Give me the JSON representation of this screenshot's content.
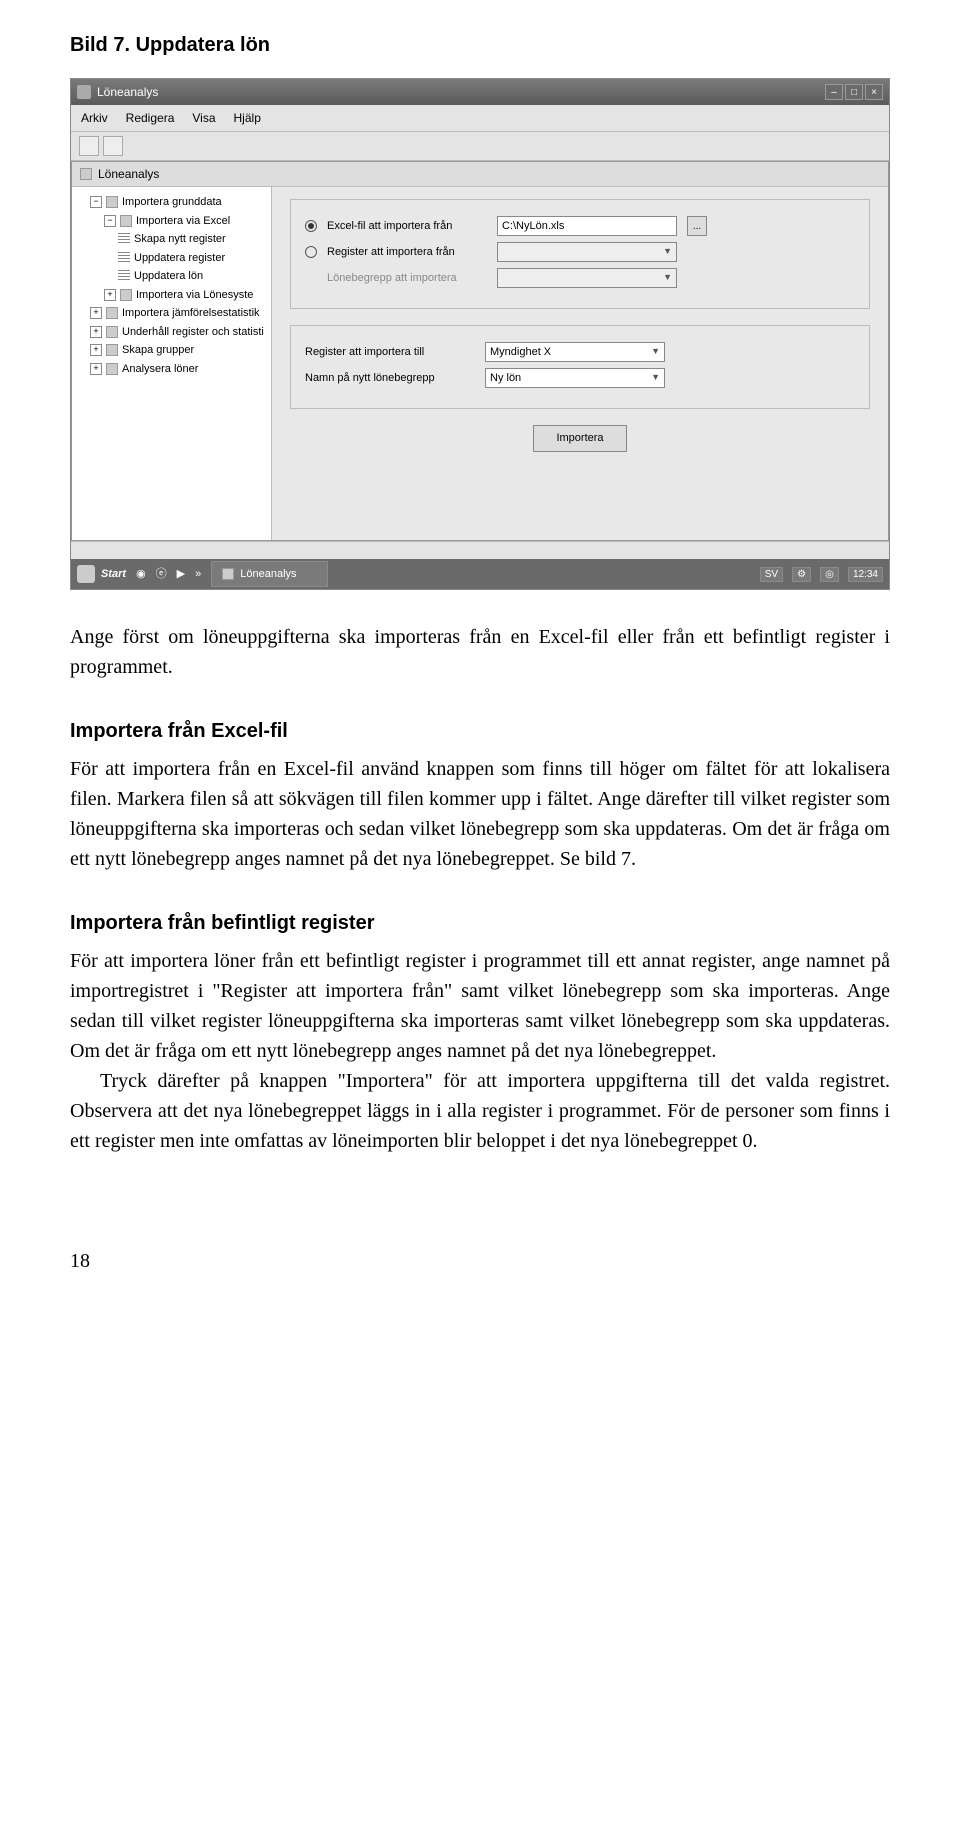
{
  "caption": "Bild 7. Uppdatera lön",
  "window": {
    "title": "Löneanalys",
    "menus": [
      "Arkiv",
      "Redigera",
      "Visa",
      "Hjälp"
    ],
    "subwindow_title": "Löneanalys",
    "tree": [
      {
        "lvl": 1,
        "ico": "minus",
        "label": "Importera grunddata"
      },
      {
        "lvl": 2,
        "ico": "folder",
        "label": "Importera via Excel"
      },
      {
        "lvl": 3,
        "ico": "lines",
        "label": "Skapa nytt register"
      },
      {
        "lvl": 3,
        "ico": "lines",
        "label": "Uppdatera register"
      },
      {
        "lvl": 3,
        "ico": "lines",
        "label": "Uppdatera lön"
      },
      {
        "lvl": 2,
        "ico": "folder",
        "label": "Importera via Lönesyste"
      },
      {
        "lvl": 1,
        "ico": "plus",
        "label": "Importera jämförelsestatistik"
      },
      {
        "lvl": 1,
        "ico": "plus",
        "label": "Underhåll register och statisti"
      },
      {
        "lvl": 1,
        "ico": "plus",
        "label": "Skapa grupper"
      },
      {
        "lvl": 1,
        "ico": "plus",
        "label": "Analysera löner"
      }
    ],
    "radio_excel": "Excel-fil att importera från",
    "radio_register": "Register att importera från",
    "lonebegrepp_import": "Lönebegrepp att importera",
    "excel_path": "C:\\NyLön.xls",
    "register_to": "Register att importera till",
    "register_to_val": "Myndighet X",
    "name_new": "Namn på nytt lönebegrepp",
    "name_new_val": "Ny lön",
    "import_btn": "Importera"
  },
  "taskbar": {
    "start": "Start",
    "task": "Löneanalys",
    "lang": "SV",
    "time": "12:34"
  },
  "para_intro": "Ange först om löneuppgifterna ska importeras från en Excel-fil eller från ett befintligt register i programmet.",
  "sec1": "Importera från Excel-fil",
  "sec1_body": "För att importera från en Excel-fil använd knappen som finns till höger om fältet för att lokalisera filen. Markera filen så att sökvägen till filen kommer upp i fältet. Ange därefter till vilket register som löneuppgifterna ska importeras och sedan vilket lönebegrepp som ska uppdateras. Om det är fråga om ett nytt lönebegrepp anges namnet på det nya lönebegreppet. Se bild 7.",
  "sec2": "Importera från befintligt register",
  "sec2_body1": "För att importera löner från ett befintligt register i programmet till ett annat register, ange namnet på importregistret i \"Register att importera från\" samt vilket lönebegrepp som ska importeras. Ange sedan till vilket register löneuppgifterna ska importeras samt vilket lönebegrepp som ska uppdateras. Om det är fråga om ett nytt lönebegrepp anges namnet på det nya lönebegreppet.",
  "sec2_body2": "Tryck därefter på knappen \"Importera\" för att importera uppgifterna till det valda registret. Observera att det nya lönebegreppet läggs in i alla register i programmet. För de personer som finns i ett register men inte omfattas av löneimporten blir beloppet i det nya lönebegreppet 0.",
  "page_num": "18"
}
